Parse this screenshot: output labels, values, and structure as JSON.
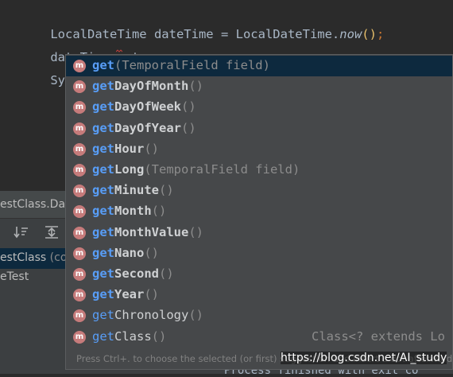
{
  "editor": {
    "line1": {
      "part1": "LocalDateTime dateTime = LocalDateTime.",
      "method": "now",
      "parens": "()",
      "semi": ";"
    },
    "line2": "dateTime.get",
    "line3": "System"
  },
  "bottom_panel": {
    "tab_title": "estClass.Dat",
    "tree": [
      {
        "label": "estClass",
        "suffix": " (co",
        "selected": true
      },
      {
        "label": "eTest",
        "suffix": "",
        "selected": false
      }
    ],
    "console_text": "Process finished with exit co"
  },
  "completion": {
    "badge_letter": "m",
    "items": [
      {
        "prefix": "get",
        "rest": "",
        "params": "(TemporalField field)",
        "type": "",
        "bold": true,
        "selected": true
      },
      {
        "prefix": "get",
        "rest": "DayOfMonth",
        "params": "()",
        "type": "",
        "bold": true,
        "selected": false
      },
      {
        "prefix": "get",
        "rest": "DayOfWeek",
        "params": "()",
        "type": "",
        "bold": true,
        "selected": false
      },
      {
        "prefix": "get",
        "rest": "DayOfYear",
        "params": "()",
        "type": "",
        "bold": true,
        "selected": false
      },
      {
        "prefix": "get",
        "rest": "Hour",
        "params": "()",
        "type": "",
        "bold": true,
        "selected": false
      },
      {
        "prefix": "get",
        "rest": "Long",
        "params": "(TemporalField field)",
        "type": "",
        "bold": true,
        "selected": false
      },
      {
        "prefix": "get",
        "rest": "Minute",
        "params": "()",
        "type": "",
        "bold": true,
        "selected": false
      },
      {
        "prefix": "get",
        "rest": "Month",
        "params": "()",
        "type": "",
        "bold": true,
        "selected": false
      },
      {
        "prefix": "get",
        "rest": "MonthValue",
        "params": "()",
        "type": "",
        "bold": true,
        "selected": false
      },
      {
        "prefix": "get",
        "rest": "Nano",
        "params": "()",
        "type": "",
        "bold": true,
        "selected": false
      },
      {
        "prefix": "get",
        "rest": "Second",
        "params": "()",
        "type": "",
        "bold": true,
        "selected": false
      },
      {
        "prefix": "get",
        "rest": "Year",
        "params": "()",
        "type": "",
        "bold": true,
        "selected": false
      },
      {
        "prefix": "get",
        "rest": "Chronology",
        "params": "()",
        "type": "",
        "bold": false,
        "selected": false
      },
      {
        "prefix": "get",
        "rest": "Class",
        "params": "()",
        "type": "Class<? extends Lo",
        "bold": false,
        "selected": false
      }
    ],
    "hint": "Press Ctrl+. to choose the selected (or first) suggestion and insert a dot afterwards  >>"
  },
  "watermark": "https://blog.csdn.net/AI_study",
  "colors": {
    "editor_bg": "#2b2b2b",
    "popup_bg": "#46484a",
    "selection": "#0d293e",
    "match_prefix": "#589df6",
    "method_badge": "#c67b7b"
  }
}
